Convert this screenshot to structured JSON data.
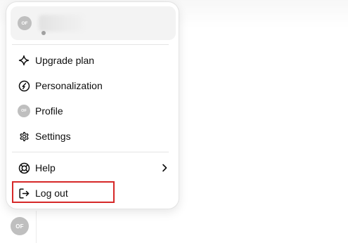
{
  "account": {
    "avatar_initials": "OF"
  },
  "menu": {
    "items": [
      {
        "label": "Upgrade plan",
        "icon": "sparkle-icon"
      },
      {
        "label": "Personalization",
        "icon": "personalization-icon"
      },
      {
        "label": "Profile",
        "icon": "avatar",
        "avatar_initials": "OF"
      },
      {
        "label": "Settings",
        "icon": "gear-icon"
      },
      {
        "label": "Help",
        "icon": "lifebuoy-icon",
        "has_submenu": true
      },
      {
        "label": "Log out",
        "icon": "logout-icon"
      }
    ]
  },
  "sidebar": {
    "avatar_initials": "OF"
  },
  "colors": {
    "highlight": "#d62828",
    "avatar_bg": "#bfbfbf"
  }
}
